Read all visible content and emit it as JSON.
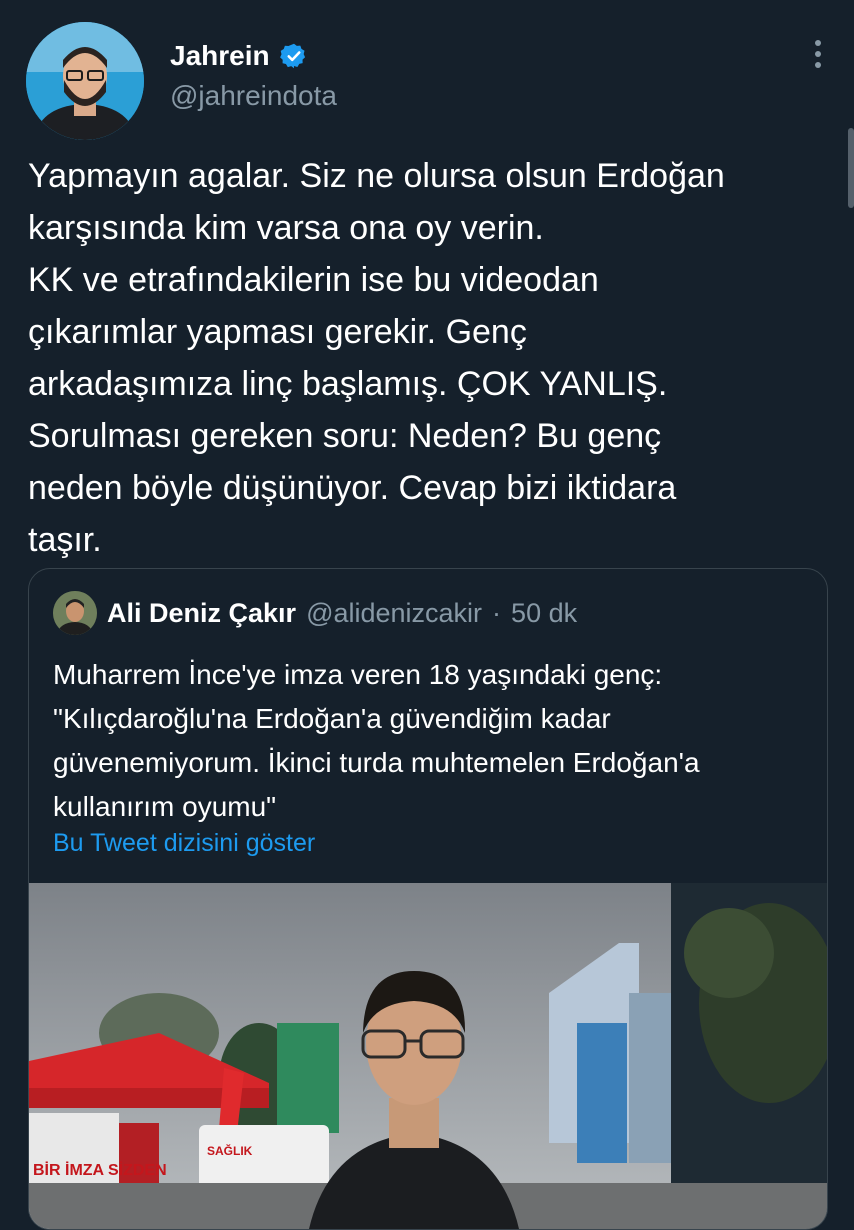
{
  "author": {
    "display_name": "Jahrein",
    "handle": "@jahreindota",
    "verified": true,
    "avatar_icon": "user-avatar"
  },
  "tweet": {
    "lines": [
      "Yapmayın agalar. Siz ne olursa olsun Erdoğan",
      "karşısında kim varsa ona oy verin.",
      "KK ve etrafındakilerin ise bu videodan",
      "çıkarımlar yapması gerekir. Genç",
      "arkadaşımıza linç başlamış. ÇOK YANLIŞ.",
      "Sorulması gereken soru: Neden? Bu genç",
      "neden böyle düşünüyor. Cevap bizi iktidara",
      "taşır."
    ]
  },
  "quote": {
    "display_name": "Ali Deniz Çakır",
    "handle": "@alidenizcakir",
    "separator": "·",
    "time": "50 dk",
    "lines": [
      "Muharrem İnce'ye imza veren 18 yaşındaki genç:",
      "\"Kılıçdaroğlu'na Erdoğan'a güvendiğim kadar",
      "güvenemiyorum. İkinci turda muhtemelen Erdoğan'a",
      "kullanırım oyumu\""
    ],
    "thread_link": "Bu Tweet dizisini göster",
    "media": {
      "banner_text": "BİR İMZA SİZDEN",
      "sign_text": "SAĞLIK"
    }
  },
  "colors": {
    "background": "#15202b",
    "border": "#38444d",
    "secondary_text": "#8899a6",
    "link": "#1d9bf0",
    "verified": "#1d9bf0"
  },
  "icons": {
    "verified": "verified-badge-icon",
    "more": "more-options-icon"
  }
}
